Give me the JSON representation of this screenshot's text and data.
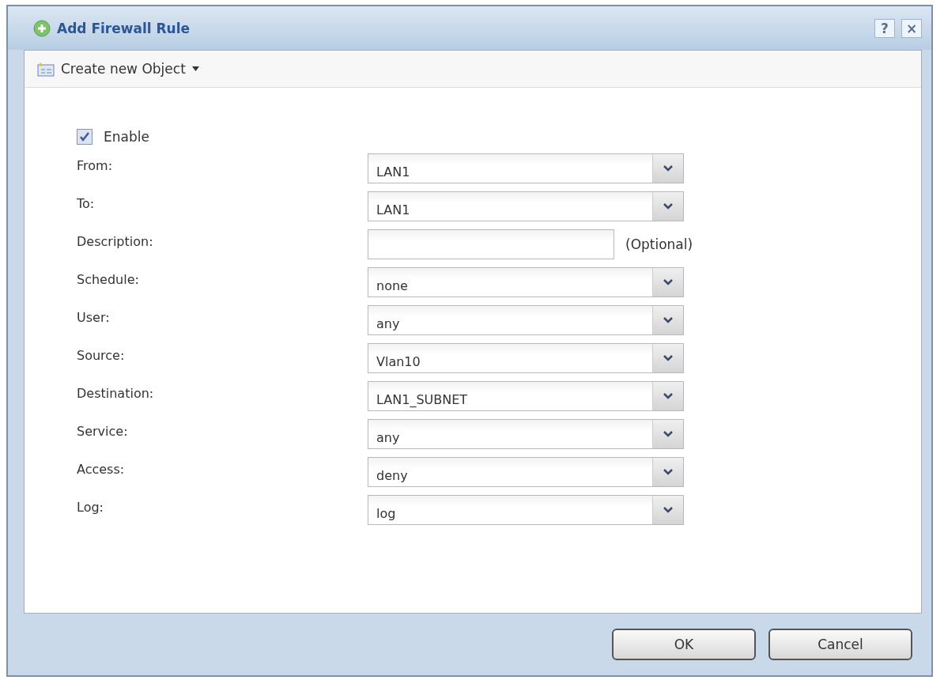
{
  "window": {
    "title": "Add Firewall Rule",
    "help": "?",
    "close": "×"
  },
  "toolbar": {
    "label": "Create new Object"
  },
  "enable": {
    "label": "Enable",
    "checked": true
  },
  "fields": [
    {
      "label": "From:",
      "kind": "select",
      "value": "LAN1"
    },
    {
      "label": "To:",
      "kind": "select",
      "value": "LAN1"
    },
    {
      "label": "Description:",
      "kind": "text",
      "note": "(Optional)"
    },
    {
      "label": "Schedule:",
      "kind": "select",
      "value": "none"
    },
    {
      "label": "User:",
      "kind": "select",
      "value": "any"
    },
    {
      "label": "Source:",
      "kind": "select",
      "value": "Vlan10"
    },
    {
      "label": "Destination:",
      "kind": "select",
      "value": "LAN1_SUBNET"
    },
    {
      "label": "Service:",
      "kind": "select",
      "value": "any"
    },
    {
      "label": "Access:",
      "kind": "select",
      "value": "deny"
    },
    {
      "label": "Log:",
      "kind": "select",
      "value": "log"
    }
  ],
  "buttons": [
    "OK",
    "Cancel"
  ]
}
